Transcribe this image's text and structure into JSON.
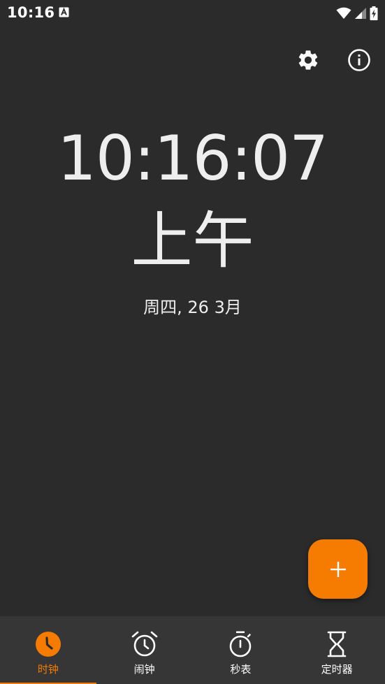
{
  "status_bar": {
    "time": "10:16",
    "icons": [
      "notification-a-icon",
      "wifi-icon",
      "signal-icon",
      "battery-charging-icon"
    ]
  },
  "toolbar": {
    "settings_icon": "gear-icon",
    "info_icon": "info-icon"
  },
  "clock": {
    "time": "10:16:07",
    "ampm": "上午",
    "date": "周四, 26 3月"
  },
  "fab": {
    "icon": "plus-icon"
  },
  "bottom_nav": {
    "items": [
      {
        "label": "时钟",
        "icon": "clock-icon",
        "active": true
      },
      {
        "label": "闹钟",
        "icon": "alarm-icon",
        "active": false
      },
      {
        "label": "秒表",
        "icon": "stopwatch-icon",
        "active": false
      },
      {
        "label": "定时器",
        "icon": "hourglass-icon",
        "active": false
      }
    ]
  },
  "colors": {
    "background": "#2b2b2b",
    "nav_background": "#363636",
    "accent": "#f57c00",
    "text": "#eeeeee"
  }
}
